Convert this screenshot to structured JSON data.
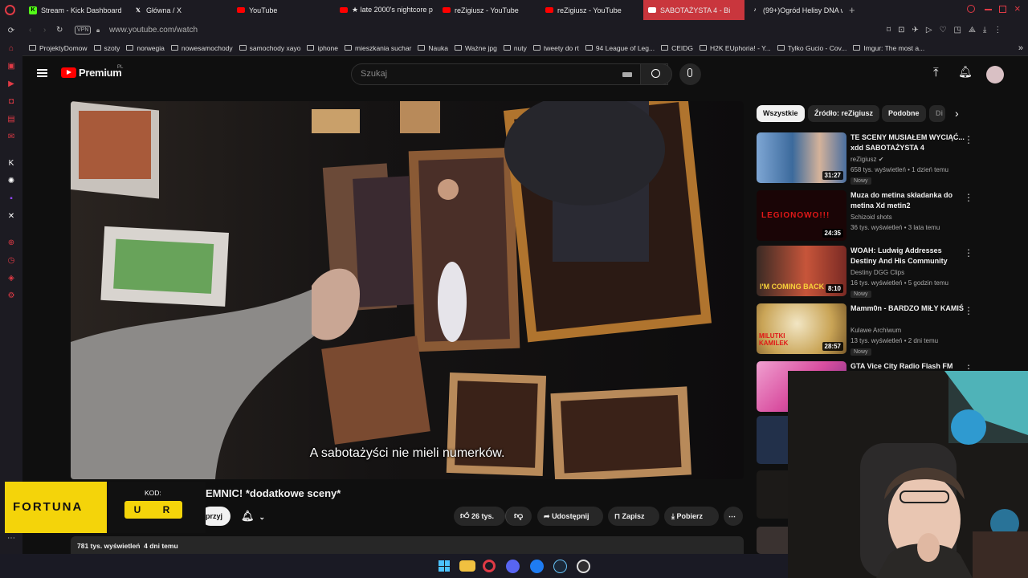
{
  "browser": {
    "tabs": [
      {
        "label": "Stream - Kick Dashboard",
        "icon": "kick-icon",
        "color": "#53fc18"
      },
      {
        "label": "Główna / X",
        "icon": "x-icon",
        "color": "#ffffff"
      },
      {
        "label": "YouTube",
        "icon": "youtube-icon",
        "color": "#ff0000"
      },
      {
        "label": "★ late 2000's nightcore p",
        "icon": "youtube-icon",
        "color": "#ff0000"
      },
      {
        "label": "reZigiusz - YouTube",
        "icon": "youtube-icon",
        "color": "#ff0000"
      },
      {
        "label": "reZigiusz - YouTube",
        "icon": "youtube-icon",
        "color": "#ff0000"
      },
      {
        "label": "SABOTAŻYSTA 4 - Bi",
        "icon": "youtube-icon",
        "color": "#ffffff",
        "active": true
      },
      {
        "label": "(99+)Ogród Helisy DNA w",
        "icon": "tiktok-icon",
        "color": "#ffffff"
      }
    ],
    "url": "www.youtube.com/watch",
    "vpn_label": "VPN",
    "bookmarks": [
      "ProjektyDomow",
      "szoty",
      "norwegia",
      "nowesamochody",
      "samochody xayo",
      "iphone",
      "mieszkania suchar",
      "Nauka",
      "Ważne jpg",
      "nuty",
      "tweety do rt",
      "94 League of Leg...",
      "CEIDG",
      "H2K EUphoria! - Y...",
      "Tylko Gucio - Cov...",
      "Imgur: The most a..."
    ]
  },
  "youtube": {
    "logo": "Premium",
    "logo_region": "PL",
    "search_placeholder": "Szukaj",
    "subtitle": "A sabotażyści nie mieli numerków.",
    "video_title": "EMNIC! *dodatkowe sceny*",
    "subscribe_fragment": "przyj",
    "likes": "26 tys.",
    "share": "Udostępnij",
    "save": "Zapisz",
    "download": "Pobierz",
    "views": "781 tys. wyświetleń  4 dni temu",
    "chips": [
      "Wszystkie",
      "Źródło: reZigiusz",
      "Podobne",
      "Di"
    ],
    "recommendations": [
      {
        "title": "TE SCENY MUSIAŁEM WYCIĄĆ... xdd SABOTAŻYSTA 4",
        "channel": "reZigiusz",
        "verified": true,
        "meta": "658 tys. wyświetleń • 1 dzień temu",
        "new": "Nowy",
        "duration": "31:27",
        "thumb": "#4a6fa0"
      },
      {
        "title": "Muza do metina składanka do metina Xd metin2",
        "channel": "Schizoid shots",
        "meta": "36 tys. wyświetleń • 3 lata temu",
        "duration": "24:35",
        "thumb": "#1a0506",
        "thumb_text": "LEGIONOWO!!!"
      },
      {
        "title": "WOAH: Ludwig Addresses Destiny And His Community",
        "channel": "Destiny DGG Clips",
        "meta": "16 tys. wyświetleń • 5 godzin temu",
        "new": "Nowy",
        "duration": "8:10",
        "thumb": "#7a2a24",
        "thumb_text": "I'M COMING BACK"
      },
      {
        "title": "Mamm0n - BARDZO MIŁY KAMIŚ",
        "channel": "Kulawe Archiwum",
        "meta": "13 tys. wyświetleń • 2 dni temu",
        "new": "Nowy",
        "duration": "28:57",
        "thumb": "#c9a456",
        "thumb_text": "MILUTKI KAMILEK"
      },
      {
        "title": "GTA Vice City Radio Flash FM",
        "channel": "",
        "meta": "",
        "duration": "",
        "thumb": "#d94fa0"
      }
    ]
  },
  "ad": {
    "brand": "FORTUNA",
    "code_label": "KOD:",
    "code": "U R"
  },
  "colors": {
    "accent": "#c9363d",
    "youtube_red": "#ff0000",
    "fortuna_yellow": "#f4d40a"
  }
}
